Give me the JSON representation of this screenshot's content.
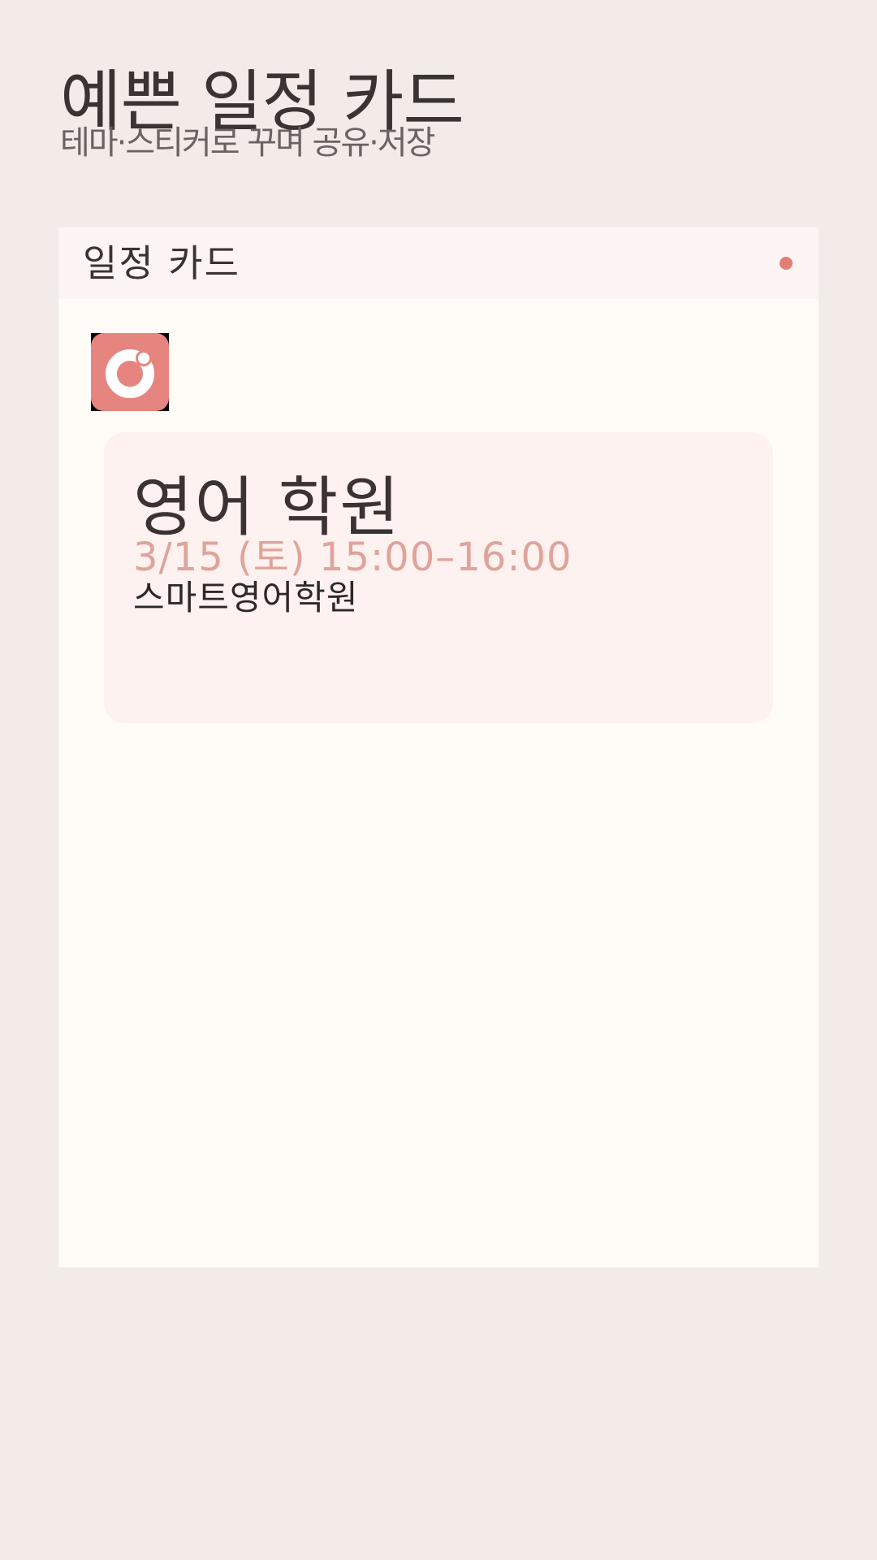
{
  "header": {
    "title": "예쁜 일정 카드",
    "subtitle": "테마·스티커로 꾸며 공유·저장"
  },
  "panel": {
    "title": "일정 카드",
    "status_dot_color": "#e27f78"
  },
  "logo": {
    "icon": "ring-logo-icon",
    "color": "#e6857f"
  },
  "event": {
    "title": "영어 학원",
    "datetime": "3/15 (토) 15:00–16:00",
    "location": "스마트영어학원"
  },
  "theme": {
    "background": "#f3ebe7",
    "card": "#fffbf7",
    "accent": "#e0a39b"
  }
}
